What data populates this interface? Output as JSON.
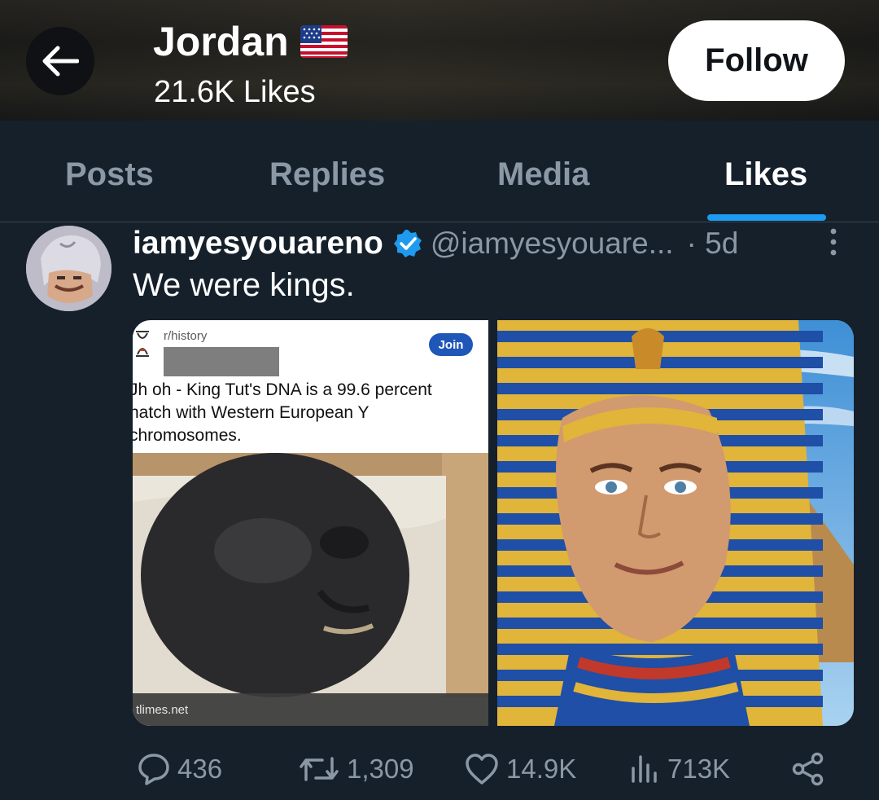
{
  "header": {
    "name": "Jordan",
    "likes_count": "21.6K Likes",
    "follow_label": "Follow"
  },
  "tabs": [
    {
      "label": "Posts",
      "active": false
    },
    {
      "label": "Replies",
      "active": false
    },
    {
      "label": "Media",
      "active": false
    },
    {
      "label": "Likes",
      "active": true
    }
  ],
  "tweet": {
    "author": "iamyesyouareno",
    "handle": "@iamyesyouare...",
    "time": "· 5d",
    "text": "We were kings.",
    "media_left": {
      "subreddit": "r/history",
      "join_label": "Join",
      "title_lines": [
        "Jh oh - King Tut's DNA is a 99.6 percent",
        "natch with Western European Y",
        "chromosomes."
      ],
      "source": "tlimes.net"
    },
    "actions": {
      "replies": "436",
      "reposts": "1,309",
      "likes": "14.9K",
      "views": "713K"
    }
  },
  "colors": {
    "background": "#15202b",
    "accent": "#1d9bf0",
    "muted_text": "#8b98a5",
    "verified": "#1d9bf0"
  }
}
